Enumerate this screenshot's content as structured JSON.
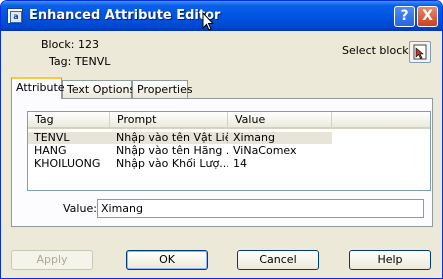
{
  "window": {
    "title": "Enhanced Attribute Editor",
    "help_symbol": "?",
    "close_symbol": "X",
    "app_icon_glyph": "a"
  },
  "block_info": {
    "block_label": "Block: 123",
    "tag_label": "Tag: TENVL"
  },
  "select_block": {
    "label": "Select block"
  },
  "tabs": [
    {
      "label": "Attribute",
      "active": true
    },
    {
      "label": "Text Options",
      "active": false
    },
    {
      "label": "Properties",
      "active": false
    }
  ],
  "attribute_list": {
    "columns": [
      "Tag",
      "Prompt",
      "Value"
    ],
    "rows": [
      {
        "tag": "TENVL",
        "prompt": "Nhập vào tên Vật Liệu",
        "value": "Ximang",
        "selected": true
      },
      {
        "tag": "HANG",
        "prompt": "Nhập vào tên Hãng ...",
        "value": "ViNaComex",
        "selected": false
      },
      {
        "tag": "KHOILUONG",
        "prompt": "Nhập vào Khối Lượ...",
        "value": "14",
        "selected": false
      }
    ]
  },
  "value_field": {
    "label": "Value:",
    "value": "Ximang"
  },
  "buttons": {
    "apply": "Apply",
    "ok": "OK",
    "cancel": "Cancel",
    "help": "Help"
  },
  "colors": {
    "title_bar": "#0054e3",
    "dialog_bg": "#ece9d8",
    "active_tab_highlight": "#ffc83c"
  },
  "icons": {
    "app": "attribute-editor-icon",
    "select_block": "pick-block-cursor-icon",
    "cursor": "mouse-pointer-icon"
  }
}
